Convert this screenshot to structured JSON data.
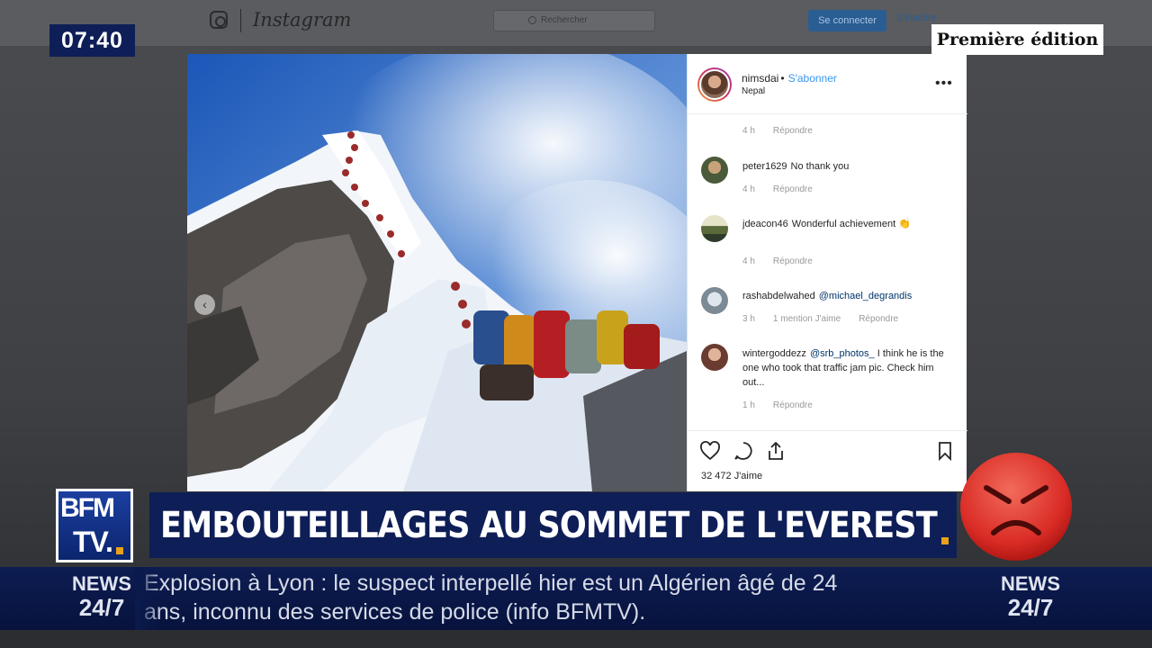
{
  "broadcast": {
    "clock": "07:40",
    "edition": "Première édition",
    "channel_logo": {
      "line1": "BFM",
      "line2": "TV."
    },
    "headline": "EMBOUTEILLAGES AU SOMMET DE L'EVEREST",
    "ticker": {
      "label_line1": "NEWS",
      "label_line2": "24/7",
      "line1": "Explosion à Lyon : le suspect interpellé hier est un Algérien âgé de 24",
      "line2": "ans, inconnu des services de police (info BFMTV)."
    },
    "reaction_emoji": "angry-face-icon",
    "colors": {
      "navy": "#0e1e57",
      "accent": "#e8a11a",
      "emoji_red": "#e53a33"
    }
  },
  "instagram": {
    "wordmark": "Instagram",
    "search_placeholder": "Rechercher",
    "login_label": "Se connecter",
    "signup_label": "S'inscrire",
    "post": {
      "author": "nimsdai",
      "follow_label": "S'abonner",
      "location": "Nepal",
      "likes": "32 472 J'aime",
      "comments": [
        {
          "user": "",
          "text": "",
          "time": "4 h",
          "reply": "Répondre",
          "likes": ""
        },
        {
          "user": "peter1629",
          "text": "No thank you",
          "time": "4 h",
          "reply": "Répondre",
          "likes": ""
        },
        {
          "user": "jdeacon46",
          "text": "Wonderful achievement 👏",
          "time": "4 h",
          "reply": "Répondre",
          "likes": ""
        },
        {
          "user": "rashabdelwahed",
          "mention": "@michael_degrandis",
          "text": "",
          "time": "3 h",
          "reply": "Répondre",
          "likes": "1 mention J'aime"
        },
        {
          "user": "wintergoddezz",
          "mention": "@srb_photos_",
          "text": "I think he is the one who took that traffic jam pic. Check him out...",
          "time": "1 h",
          "reply": "Répondre",
          "likes": ""
        }
      ]
    }
  }
}
